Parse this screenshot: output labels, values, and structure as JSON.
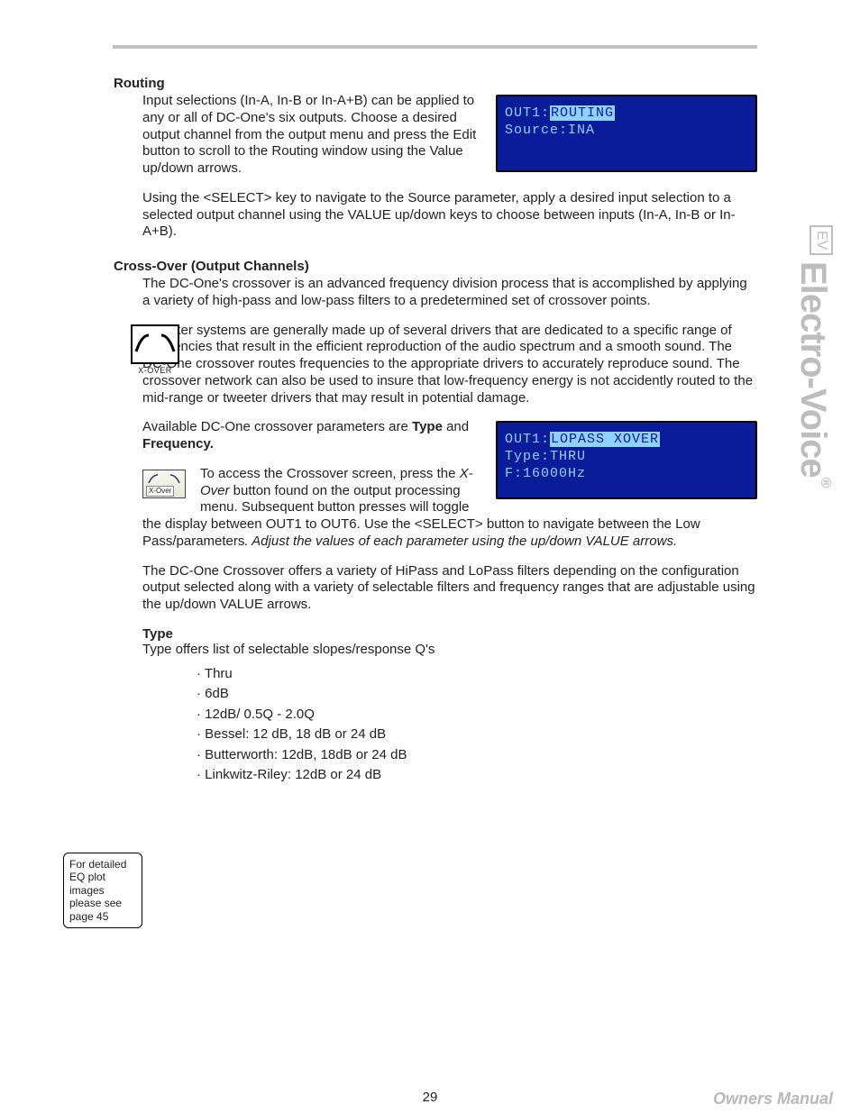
{
  "sections": {
    "routing": {
      "title": "Routing",
      "p1": "Input selections (In-A, In-B or In-A+B) can be applied to any or all of DC-One's six outputs. Choose a desired output channel from the output menu and press the Edit button to scroll to the Routing window using the Value up/down arrows.",
      "p2": "Using the <SELECT> key to navigate to the Source parameter, apply a desired input selection to a selected output channel using the VALUE up/down keys to choose between inputs (In-A, In-B or In-A+B)."
    },
    "xover": {
      "title": "Cross-Over (Output Channels)",
      "icon_label": "X-OVER",
      "p1": "The DC-One's crossover is an advanced frequency division process that is accomplished by applying a variety of high-pass and low-pass filters to a predetermined set of crossover points.",
      "p2": "Speaker systems are generally made up of several drivers that are dedicated to a specific range of frequencies that result in the efficient reproduction of the audio spectrum and a smooth sound. The DC-One crossover routes frequencies to the appropriate drivers to accurately reproduce sound. The crossover network can also be used to insure that low-frequency energy is not accidently routed to the mid-range or tweeter drivers that may result in potential damage.",
      "p3_pre": "Available DC-One crossover parameters are ",
      "p3_b1": "Type",
      "p3_mid": " and ",
      "p3_b2": "Frequency.",
      "button_label": "X-Over",
      "p4_pre": "To access the Crossover screen, press the ",
      "p4_i": "X-Over",
      "p4_post": " button found on the output processing menu. Subsequent button presses will toggle the display between OUT1 to OUT6. Use the <SELECT> button to navigate between the Low Pass/parameters",
      "p4_tail": ". Adjust the values of each parameter using the up/down VALUE arrows.",
      "p5": "The DC-One Crossover offers a variety of HiPass and LoPass filters depending on the configuration output selected along with a variety of selectable filters and frequency ranges that are adjustable using the up/down VALUE arrows."
    },
    "type": {
      "title": "Type",
      "p1": "Type offers list of selectable slopes/response Q's",
      "items": [
        "Thru",
        "6dB",
        "12dB/ 0.5Q - 2.0Q",
        "Bessel: 12 dB, 18 dB or 24 dB",
        "Butterworth: 12dB, 18dB or 24 dB",
        "Linkwitz-Riley: 12dB or 24 dB"
      ]
    }
  },
  "lcd1": {
    "l1_pre": "OUT1:",
    "l1_hl": "ROUTING",
    "l2": "Source:INA"
  },
  "lcd2": {
    "l1_pre": "OUT1:",
    "l1_hl": "LOPASS XOVER",
    "l2": "Type:THRU",
    "l3": "F:16000Hz"
  },
  "note": "For detailed EQ plot images please see page 45",
  "brand": {
    "ev": "EV",
    "name": "Electro-Voice",
    "reg": "®"
  },
  "footer": {
    "page": "29",
    "owners": "Owners Manual"
  }
}
